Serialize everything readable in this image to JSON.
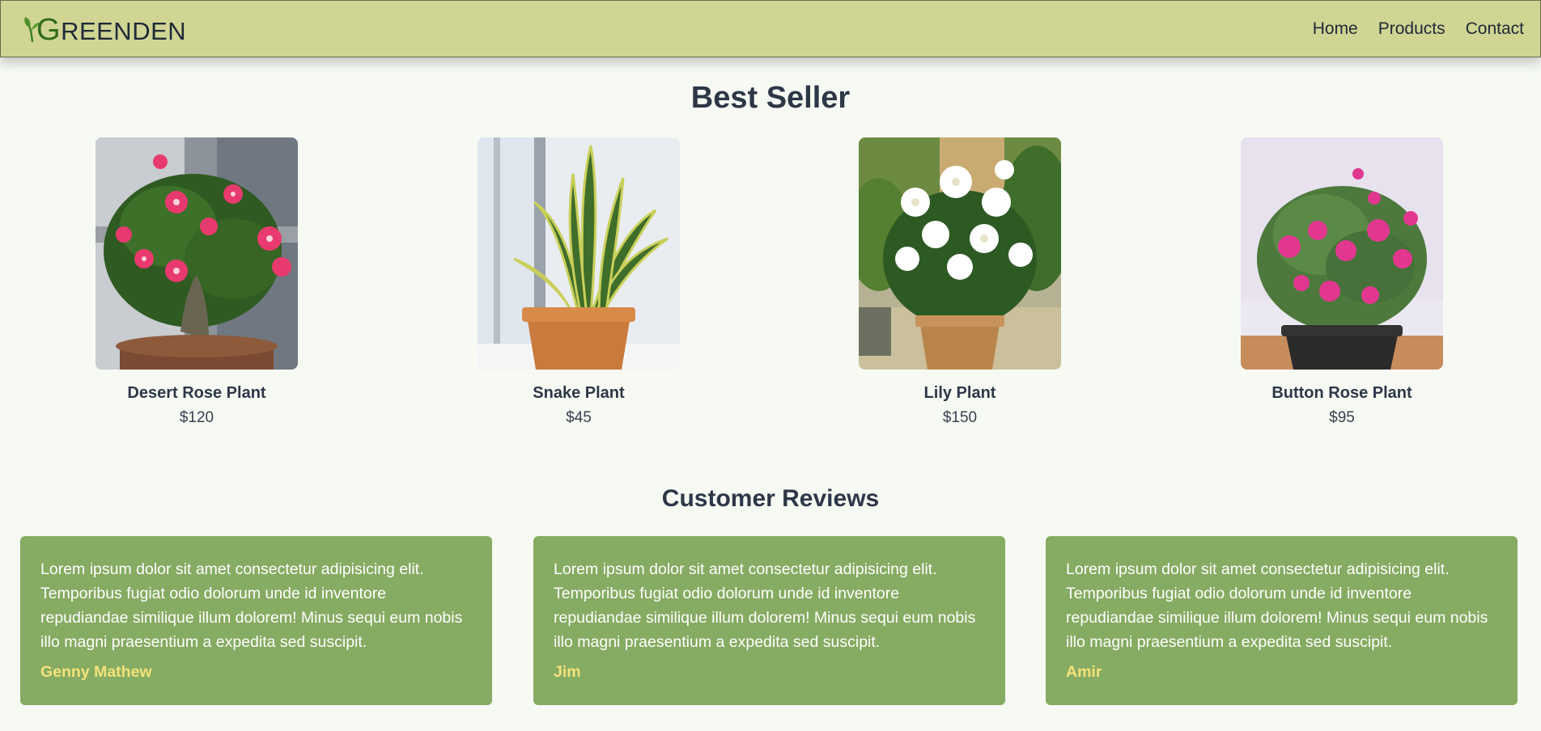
{
  "header": {
    "logo_first": "G",
    "logo_rest": "REENDEN",
    "nav": [
      {
        "label": "Home"
      },
      {
        "label": "Products"
      },
      {
        "label": "Contact"
      }
    ]
  },
  "best_seller": {
    "title": "Best Seller",
    "products": [
      {
        "name": "Desert Rose Plant",
        "price": "$120"
      },
      {
        "name": "Snake Plant",
        "price": "$45"
      },
      {
        "name": "Lily Plant",
        "price": "$150"
      },
      {
        "name": "Button Rose Plant",
        "price": "$95"
      }
    ]
  },
  "reviews": {
    "title": "Customer Reviews",
    "items": [
      {
        "text": "Lorem ipsum dolor sit amet consectetur adipisicing elit. Temporibus fugiat odio dolorum unde id inventore repudiandae similique illum dolorem! Minus sequi eum nobis illo magni praesentium a expedita sed suscipit.",
        "author": "Genny Mathew"
      },
      {
        "text": "Lorem ipsum dolor sit amet consectetur adipisicing elit. Temporibus fugiat odio dolorum unde id inventore repudiandae similique illum dolorem! Minus sequi eum nobis illo magni praesentium a expedita sed suscipit.",
        "author": "Jim"
      },
      {
        "text": "Lorem ipsum dolor sit amet consectetur adipisicing elit. Temporibus fugiat odio dolorum unde id inventore repudiandae similique illum dolorem! Minus sequi eum nobis illo magni praesentium a expedita sed suscipit.",
        "author": "Amir"
      }
    ]
  },
  "colors": {
    "header_bg": "#d0d594",
    "page_bg": "#f6faf3",
    "review_bg": "#86ab62",
    "author_color": "#f4e27a",
    "heading_color": "#2d3748"
  }
}
